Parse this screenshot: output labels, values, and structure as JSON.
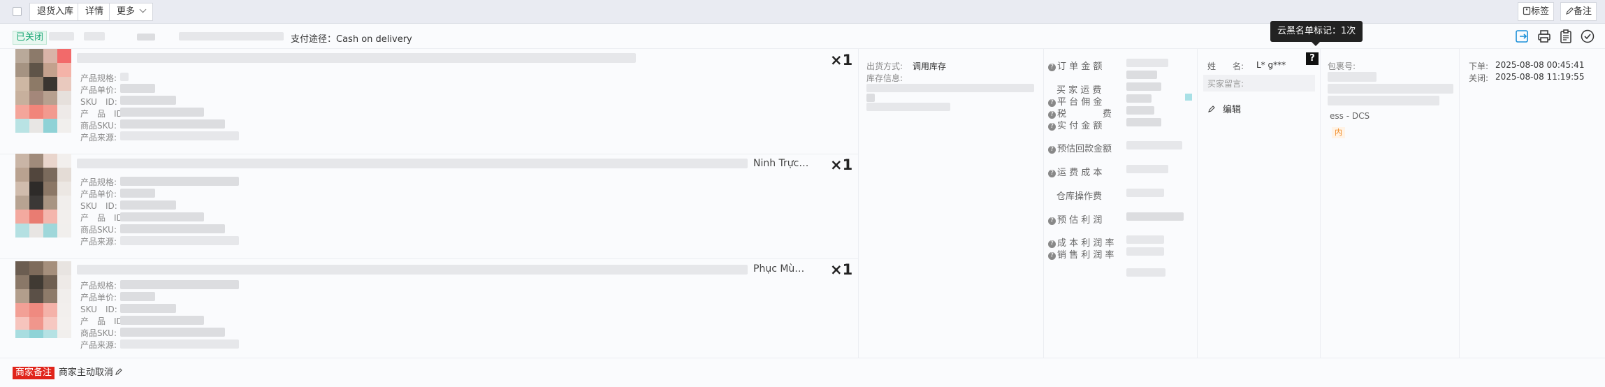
{
  "toolbar": {
    "return_label": "退货入库",
    "detail_label": "详情",
    "more_label": "更多",
    "tag_label": "标签",
    "note_label": "备注"
  },
  "order": {
    "status": "已关闭",
    "payment_label": "支付途径：",
    "payment_value": "Cash on delivery"
  },
  "product_labels": {
    "spec": "产品规格:",
    "price": "产品单价:",
    "sku_id": "SKU　ID:",
    "product_id": "产　品　ID:",
    "goods_sku": "商品SKU:",
    "source": "产品来源:"
  },
  "products": [
    {
      "variant": "",
      "qty": "×1"
    },
    {
      "variant": "Ninh Trực…",
      "qty": "×1"
    },
    {
      "variant": "Phục Mù…",
      "qty": "×1"
    }
  ],
  "shipping": {
    "method_label": "出货方式:",
    "method_value": "调用库存",
    "stock_label": "库存信息:"
  },
  "finance": {
    "order_amount": "订 单 金 额",
    "buyer_shipping": "买 家 运 费",
    "platform_commission": "平 台 佣 金",
    "tax": "税　　　　费",
    "paid_amount": "实 付 金 额",
    "estimated_payout": "预估回款金额",
    "shipping_cost": "运 费 成 本",
    "warehouse_fee": "仓库操作费",
    "estimated_profit": "预 估 利 润",
    "cost_margin": "成 本 利 润 率",
    "sales_margin": "销 售 利 润 率"
  },
  "buyer": {
    "name_label": "姓　　名:",
    "name_value": "L* g***",
    "message_label": "买家留言:",
    "edit_label": "编辑"
  },
  "blacklist_tooltip": "云黑名单标记：1次",
  "blacklist_icon": "?",
  "package": {
    "label": "包裹号:",
    "code_fragment": "ess - DCS",
    "tag": "内"
  },
  "times": {
    "order_label": "下单:",
    "order_time": "2025-08-08 00:45:41",
    "close_label": "关闭:",
    "close_time": "2025-08-08 11:19:55"
  },
  "footer": {
    "merchant_note": "商家备注",
    "cancel_text": "商家主动取消"
  },
  "colors": {
    "status_green": "#17a673",
    "merchant_red": "#e0241b",
    "accent_blue": "#1a8fd8"
  }
}
